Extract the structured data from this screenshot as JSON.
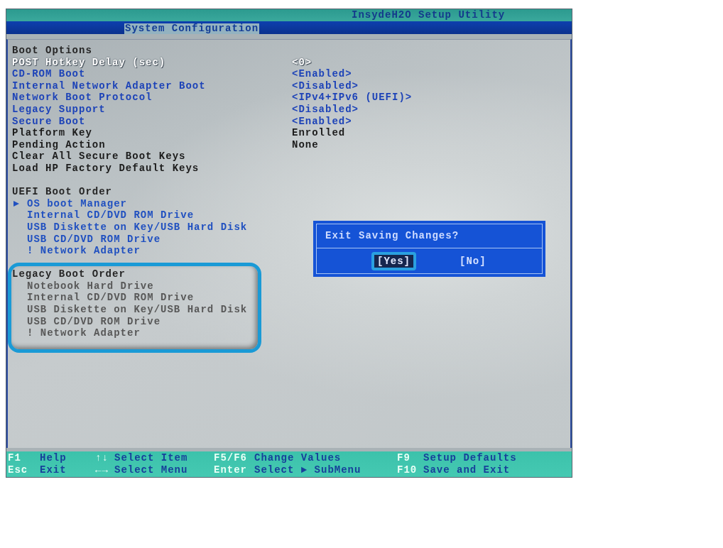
{
  "window": {
    "title": "InsydeH2O Setup Utility"
  },
  "tabs": [
    {
      "label": "System Configuration",
      "selected": true
    }
  ],
  "sections": [
    {
      "kind": "settings",
      "title": "Boot Options",
      "highlighted": false,
      "items": [
        {
          "label": "POST Hotkey Delay (sec)",
          "value": "<0>",
          "kind": "option",
          "selected": true
        },
        {
          "label": "CD-ROM Boot",
          "value": "<Enabled>",
          "kind": "option",
          "selected": false
        },
        {
          "label": "Internal Network Adapter Boot",
          "value": "<Disabled>",
          "kind": "option",
          "selected": false
        },
        {
          "label": "Network Boot Protocol",
          "value": "<IPv4+IPv6 (UEFI)>",
          "kind": "option",
          "selected": false
        },
        {
          "label": "Legacy Support",
          "value": "<Disabled>",
          "kind": "option",
          "selected": false
        },
        {
          "label": "Secure Boot",
          "value": "<Enabled>",
          "kind": "option",
          "selected": false
        },
        {
          "label": "Platform Key",
          "value": "Enrolled",
          "kind": "plain",
          "selected": false
        },
        {
          "label": "Pending Action",
          "value": "None",
          "kind": "plain",
          "selected": false
        },
        {
          "label": "Clear All Secure Boot Keys",
          "kind": "plain",
          "selected": false
        },
        {
          "label": "Load HP Factory Default Keys",
          "kind": "plain",
          "selected": false
        }
      ]
    },
    {
      "kind": "boot_order",
      "title": "UEFI Boot Order",
      "highlighted": false,
      "items": [
        {
          "label": "OS boot Manager",
          "disabled": false,
          "children": [
            {
              "label": "Internal CD/DVD ROM Drive",
              "disabled": false
            },
            {
              "label": "USB Diskette on Key/USB Hard Disk",
              "disabled": false
            },
            {
              "label": "USB CD/DVD ROM Drive",
              "disabled": false
            },
            {
              "label": "! Network Adapter",
              "disabled": false
            }
          ]
        }
      ]
    },
    {
      "kind": "boot_order",
      "title": "Legacy Boot Order",
      "highlighted": true,
      "items": [
        {
          "label": "Notebook Hard Drive",
          "disabled": true
        },
        {
          "label": "Internal CD/DVD ROM Drive",
          "disabled": true
        },
        {
          "label": "USB Diskette on Key/USB Hard Disk",
          "disabled": true
        },
        {
          "label": "USB CD/DVD ROM Drive",
          "disabled": true
        },
        {
          "label": "! Network Adapter",
          "disabled": true
        }
      ]
    }
  ],
  "dialog": {
    "title": "Exit Saving Changes?",
    "buttons": [
      {
        "label": "[Yes]",
        "selected": true
      },
      {
        "label": "[No]",
        "selected": false
      }
    ]
  },
  "key_hints": [
    {
      "key": "F1",
      "action": "Help"
    },
    {
      "key": "↑↓",
      "action": "Select Item"
    },
    {
      "key": "F5/F6",
      "action": "Change Values"
    },
    {
      "key": "F9",
      "action": "Setup Defaults"
    },
    {
      "key": "Esc",
      "action": "Exit"
    },
    {
      "key": "←→",
      "action": "Select Menu"
    },
    {
      "key": "Enter",
      "action": "Select ► SubMenu"
    },
    {
      "key": "F10",
      "action": "Save and Exit"
    }
  ]
}
